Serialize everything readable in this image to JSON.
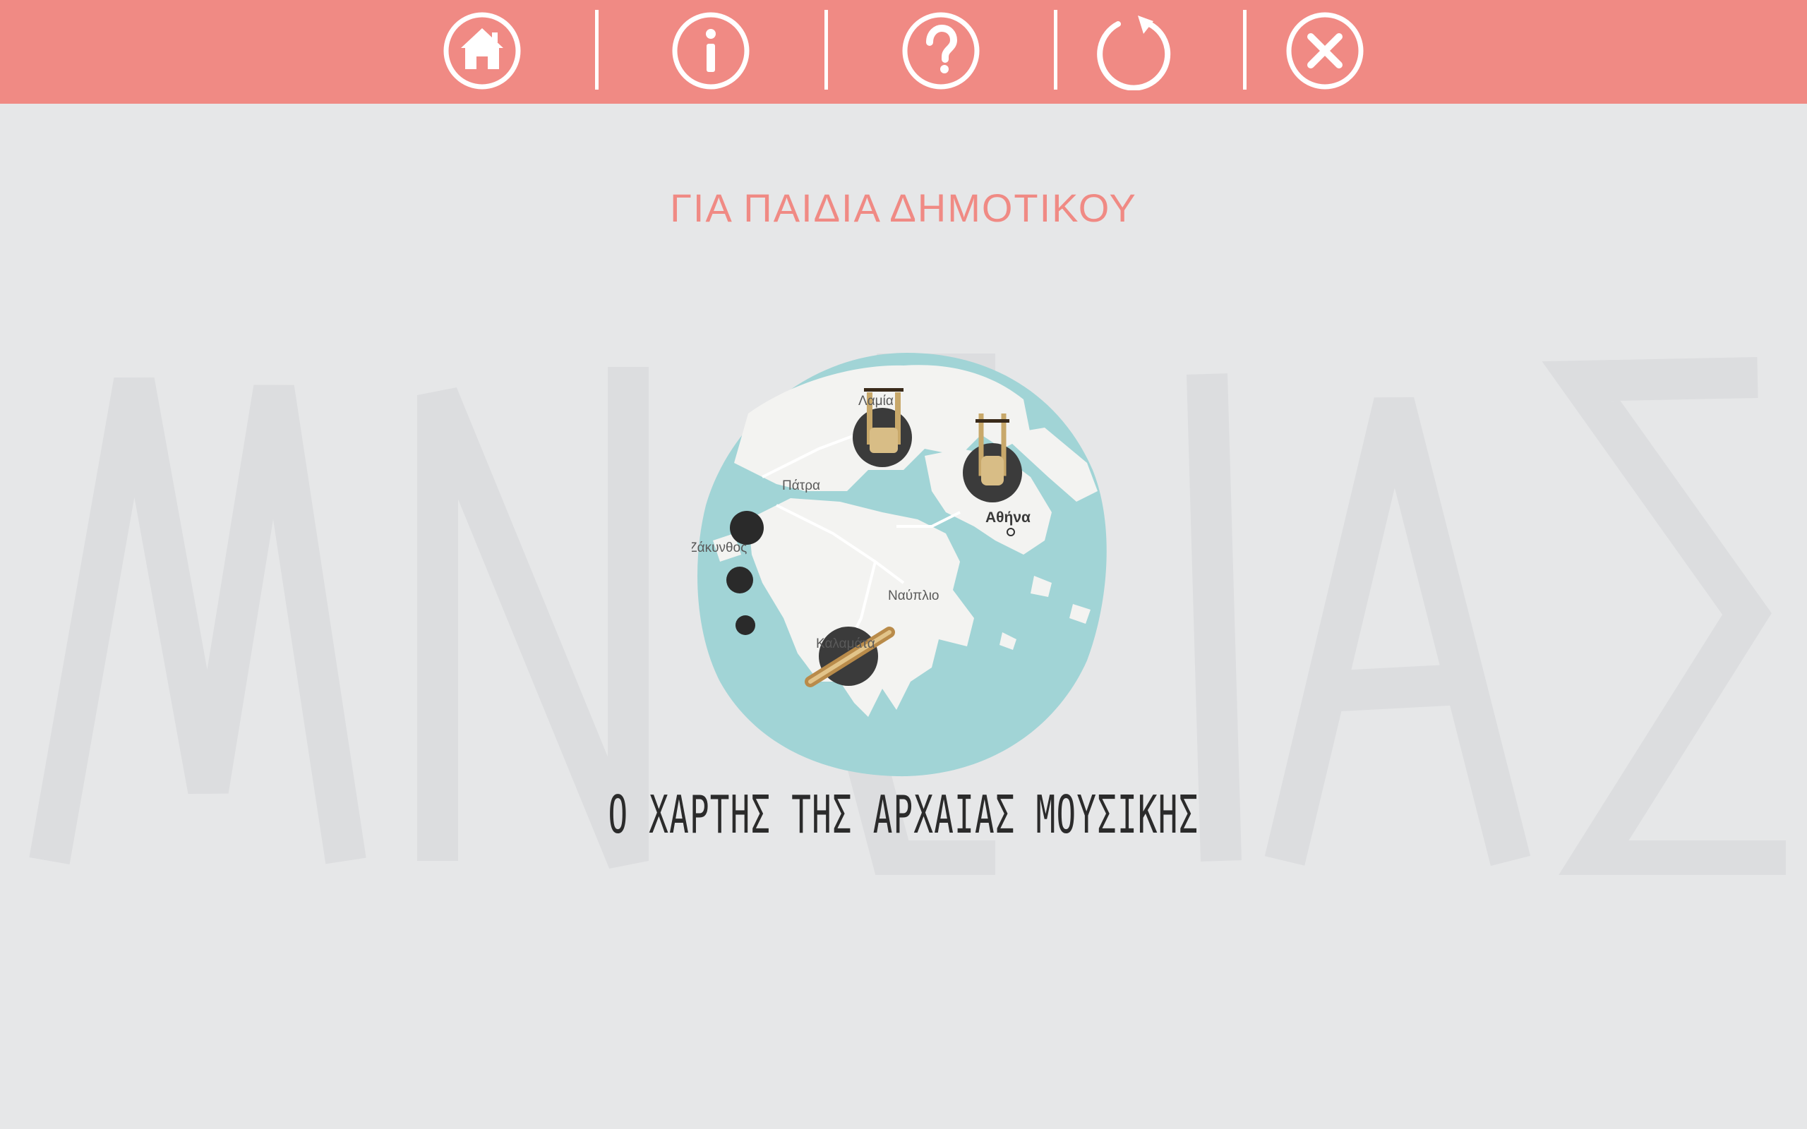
{
  "toolbar": {
    "color": "#f08a84",
    "buttons": [
      {
        "name": "home",
        "icon": "home-icon"
      },
      {
        "name": "info",
        "icon": "info-icon"
      },
      {
        "name": "help",
        "icon": "help-icon"
      },
      {
        "name": "restart",
        "icon": "refresh-icon"
      },
      {
        "name": "close",
        "icon": "close-icon"
      }
    ]
  },
  "watermark": {
    "text": "MNΣΙΑΣ",
    "color": "#dcdddf"
  },
  "subtitle": "ΓΙΑ ΠΑΙΔΙΑ ΔΗΜΟΤΙΚΟΥ",
  "map": {
    "labels": {
      "lamia": "Λαμία",
      "patra": "Πάτρα",
      "athina": "Αθήνα",
      "zakynthos": "Ζάκυνθος",
      "nafplio": "Ναύπλιο",
      "kalamata": "Καλαμάτα"
    },
    "sea_color": "#a1d4d6",
    "land_color": "#f3f3f1"
  },
  "title": "Ο ΧΑΡΤΗΣ ΤΗΣ ΑΡΧΑΙΑΣ ΜΟΥΣΙΚΗΣ"
}
